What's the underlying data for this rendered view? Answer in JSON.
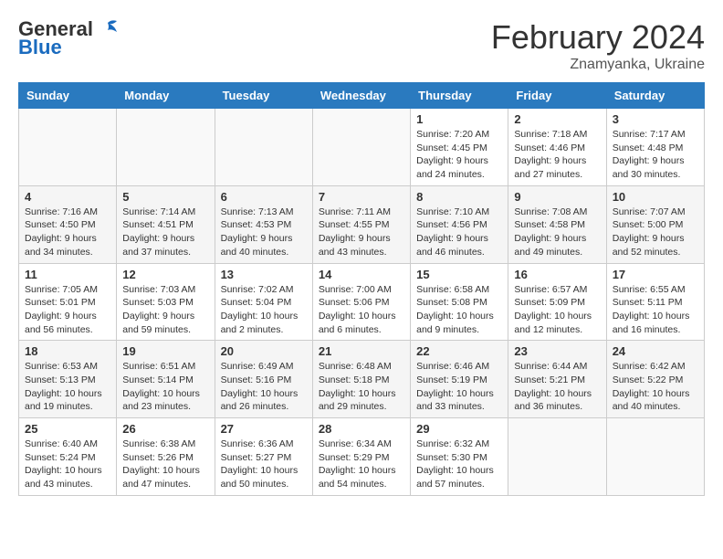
{
  "header": {
    "logo": {
      "line1": "General",
      "line2": "Blue"
    },
    "title": "February 2024",
    "location": "Znamyanka, Ukraine"
  },
  "weekdays": [
    "Sunday",
    "Monday",
    "Tuesday",
    "Wednesday",
    "Thursday",
    "Friday",
    "Saturday"
  ],
  "weeks": [
    [
      {
        "day": "",
        "info": ""
      },
      {
        "day": "",
        "info": ""
      },
      {
        "day": "",
        "info": ""
      },
      {
        "day": "",
        "info": ""
      },
      {
        "day": "1",
        "info": "Sunrise: 7:20 AM\nSunset: 4:45 PM\nDaylight: 9 hours\nand 24 minutes."
      },
      {
        "day": "2",
        "info": "Sunrise: 7:18 AM\nSunset: 4:46 PM\nDaylight: 9 hours\nand 27 minutes."
      },
      {
        "day": "3",
        "info": "Sunrise: 7:17 AM\nSunset: 4:48 PM\nDaylight: 9 hours\nand 30 minutes."
      }
    ],
    [
      {
        "day": "4",
        "info": "Sunrise: 7:16 AM\nSunset: 4:50 PM\nDaylight: 9 hours\nand 34 minutes."
      },
      {
        "day": "5",
        "info": "Sunrise: 7:14 AM\nSunset: 4:51 PM\nDaylight: 9 hours\nand 37 minutes."
      },
      {
        "day": "6",
        "info": "Sunrise: 7:13 AM\nSunset: 4:53 PM\nDaylight: 9 hours\nand 40 minutes."
      },
      {
        "day": "7",
        "info": "Sunrise: 7:11 AM\nSunset: 4:55 PM\nDaylight: 9 hours\nand 43 minutes."
      },
      {
        "day": "8",
        "info": "Sunrise: 7:10 AM\nSunset: 4:56 PM\nDaylight: 9 hours\nand 46 minutes."
      },
      {
        "day": "9",
        "info": "Sunrise: 7:08 AM\nSunset: 4:58 PM\nDaylight: 9 hours\nand 49 minutes."
      },
      {
        "day": "10",
        "info": "Sunrise: 7:07 AM\nSunset: 5:00 PM\nDaylight: 9 hours\nand 52 minutes."
      }
    ],
    [
      {
        "day": "11",
        "info": "Sunrise: 7:05 AM\nSunset: 5:01 PM\nDaylight: 9 hours\nand 56 minutes."
      },
      {
        "day": "12",
        "info": "Sunrise: 7:03 AM\nSunset: 5:03 PM\nDaylight: 9 hours\nand 59 minutes."
      },
      {
        "day": "13",
        "info": "Sunrise: 7:02 AM\nSunset: 5:04 PM\nDaylight: 10 hours\nand 2 minutes."
      },
      {
        "day": "14",
        "info": "Sunrise: 7:00 AM\nSunset: 5:06 PM\nDaylight: 10 hours\nand 6 minutes."
      },
      {
        "day": "15",
        "info": "Sunrise: 6:58 AM\nSunset: 5:08 PM\nDaylight: 10 hours\nand 9 minutes."
      },
      {
        "day": "16",
        "info": "Sunrise: 6:57 AM\nSunset: 5:09 PM\nDaylight: 10 hours\nand 12 minutes."
      },
      {
        "day": "17",
        "info": "Sunrise: 6:55 AM\nSunset: 5:11 PM\nDaylight: 10 hours\nand 16 minutes."
      }
    ],
    [
      {
        "day": "18",
        "info": "Sunrise: 6:53 AM\nSunset: 5:13 PM\nDaylight: 10 hours\nand 19 minutes."
      },
      {
        "day": "19",
        "info": "Sunrise: 6:51 AM\nSunset: 5:14 PM\nDaylight: 10 hours\nand 23 minutes."
      },
      {
        "day": "20",
        "info": "Sunrise: 6:49 AM\nSunset: 5:16 PM\nDaylight: 10 hours\nand 26 minutes."
      },
      {
        "day": "21",
        "info": "Sunrise: 6:48 AM\nSunset: 5:18 PM\nDaylight: 10 hours\nand 29 minutes."
      },
      {
        "day": "22",
        "info": "Sunrise: 6:46 AM\nSunset: 5:19 PM\nDaylight: 10 hours\nand 33 minutes."
      },
      {
        "day": "23",
        "info": "Sunrise: 6:44 AM\nSunset: 5:21 PM\nDaylight: 10 hours\nand 36 minutes."
      },
      {
        "day": "24",
        "info": "Sunrise: 6:42 AM\nSunset: 5:22 PM\nDaylight: 10 hours\nand 40 minutes."
      }
    ],
    [
      {
        "day": "25",
        "info": "Sunrise: 6:40 AM\nSunset: 5:24 PM\nDaylight: 10 hours\nand 43 minutes."
      },
      {
        "day": "26",
        "info": "Sunrise: 6:38 AM\nSunset: 5:26 PM\nDaylight: 10 hours\nand 47 minutes."
      },
      {
        "day": "27",
        "info": "Sunrise: 6:36 AM\nSunset: 5:27 PM\nDaylight: 10 hours\nand 50 minutes."
      },
      {
        "day": "28",
        "info": "Sunrise: 6:34 AM\nSunset: 5:29 PM\nDaylight: 10 hours\nand 54 minutes."
      },
      {
        "day": "29",
        "info": "Sunrise: 6:32 AM\nSunset: 5:30 PM\nDaylight: 10 hours\nand 57 minutes."
      },
      {
        "day": "",
        "info": ""
      },
      {
        "day": "",
        "info": ""
      }
    ]
  ]
}
